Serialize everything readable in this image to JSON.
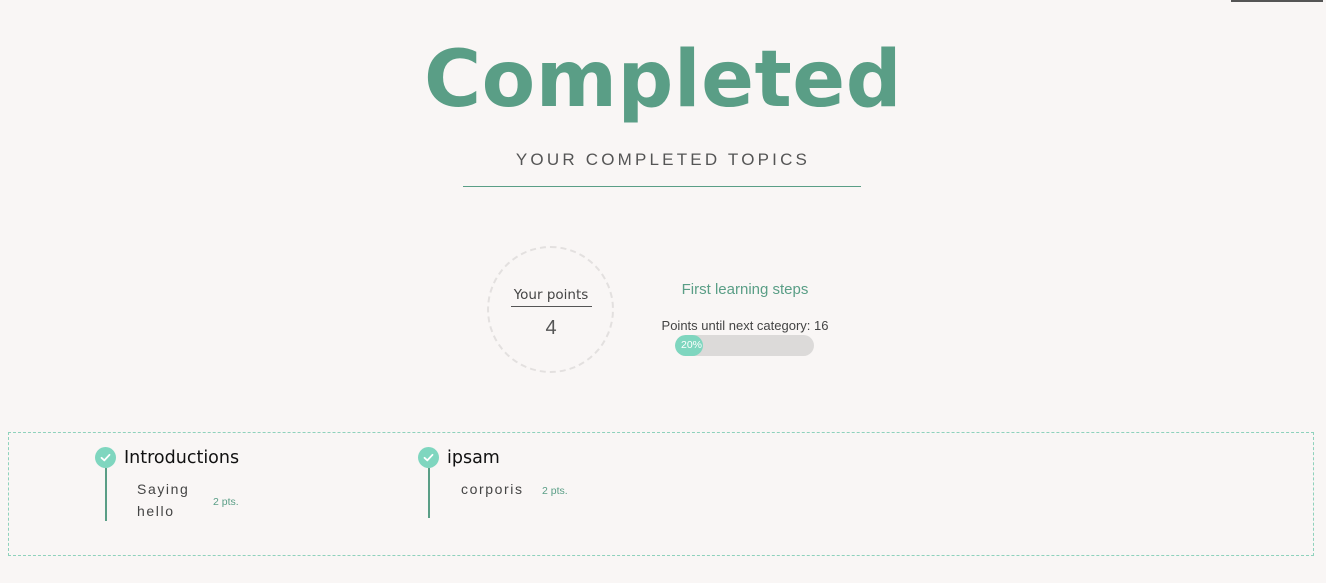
{
  "header": {
    "title": "Completed",
    "subtitle": "YOUR COMPLETED TOPICS"
  },
  "points": {
    "label": "Your points",
    "value": "4"
  },
  "category": {
    "name": "First learning steps",
    "next_text": "Points until next category: 16",
    "progress_label": "20%",
    "progress_percent": 20
  },
  "topics": [
    {
      "title": "Introductions",
      "lesson": "Saying hello",
      "points": "2 pts."
    },
    {
      "title": "ipsam",
      "lesson": "corporis",
      "points": "2 pts."
    }
  ],
  "colors": {
    "accent": "#5a9e86",
    "check": "#7fd6bf",
    "background": "#f9f6f5"
  },
  "icons": {
    "check": "check-icon"
  }
}
